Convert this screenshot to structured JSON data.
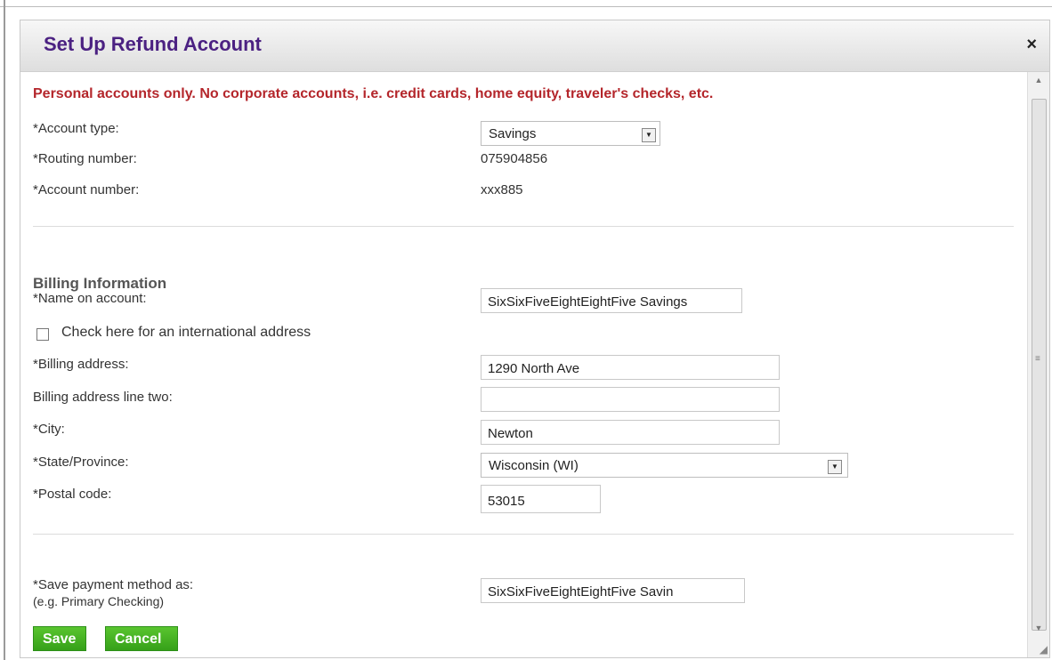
{
  "dialog": {
    "title": "Set Up Refund Account",
    "close_icon": "×"
  },
  "form": {
    "warning": "Personal accounts only. No corporate accounts, i.e. credit cards, home equity, traveler's checks, etc.",
    "account_type_label": "*Account type:",
    "account_type_value": "Savings",
    "routing_label": "*Routing number:",
    "routing_value": "075904856",
    "account_number_label": "*Account number:",
    "account_number_value": "xxx885",
    "billing_heading": "Billing Information",
    "name_label": "*Name on account:",
    "name_value": "SixSixFiveEightEightFive Savings",
    "international_label": "Check here for an international address",
    "billing_address_label": "*Billing address:",
    "billing_address_value": "1290 North Ave",
    "billing_address2_label": "Billing address line two:",
    "billing_address2_value": "",
    "city_label": "*City:",
    "city_value": "Newton",
    "state_label": "*State/Province:",
    "state_value": "Wisconsin (WI)",
    "postal_label": "*Postal code:",
    "postal_value": "53015",
    "save_as_label": "*Save payment method as:",
    "save_as_hint": "(e.g. Primary Checking)",
    "save_as_value": "SixSixFiveEightEightFive Savin",
    "save_button": "Save",
    "cancel_button": "Cancel"
  },
  "icons": {
    "dropdown_arrow": "▼",
    "scroll_up": "▲",
    "scroll_down": "▼",
    "scroll_grip": "≡",
    "resize": "◢"
  },
  "colors": {
    "title": "#4b2182",
    "warning": "#b4262b",
    "button": "#3ea91e"
  }
}
